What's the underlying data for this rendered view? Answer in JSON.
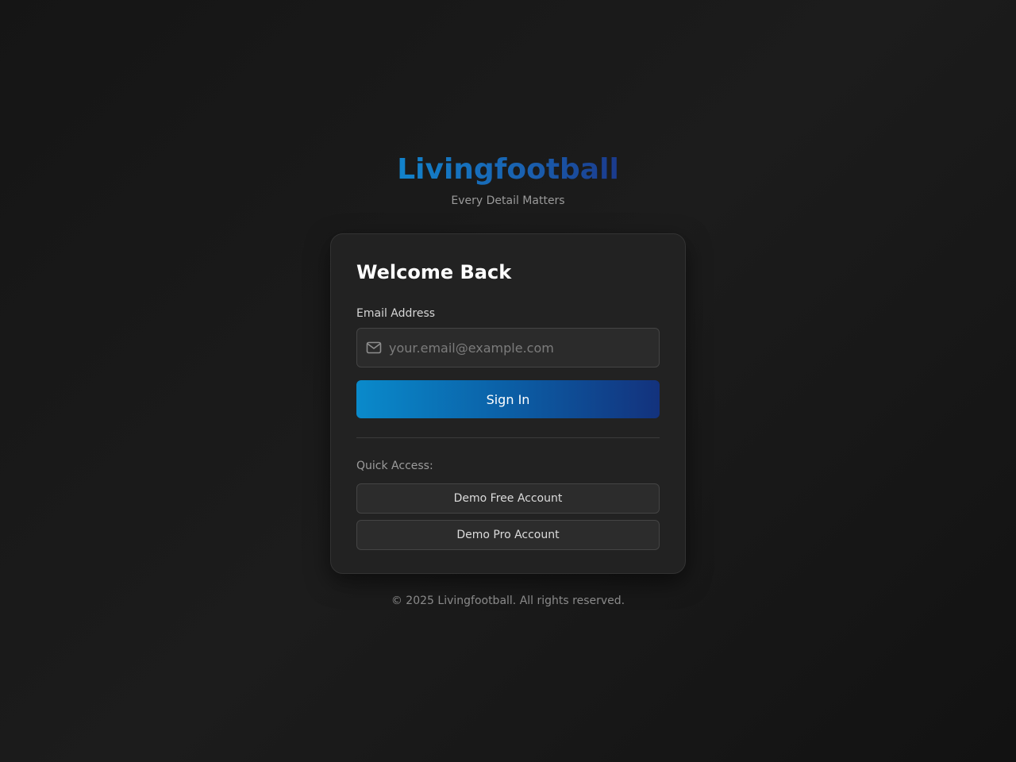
{
  "brand": {
    "title": "Livingfootball",
    "tagline": "Every Detail Matters"
  },
  "login": {
    "title": "Welcome Back",
    "email_label": "Email Address",
    "email_placeholder": "your.email@example.com",
    "email_value": "",
    "email_icon": "mail-icon",
    "signin_label": "Sign In",
    "quick_access_label": "Quick Access:",
    "demo_free_label": "Demo Free Account",
    "demo_pro_label": "Demo Pro Account"
  },
  "footer": {
    "copyright": "© 2025 Livingfootball. All rights reserved."
  },
  "colors": {
    "accent_start": "#0a8acb",
    "accent_end": "#13327d",
    "background": "#171717",
    "card": "#222222"
  }
}
